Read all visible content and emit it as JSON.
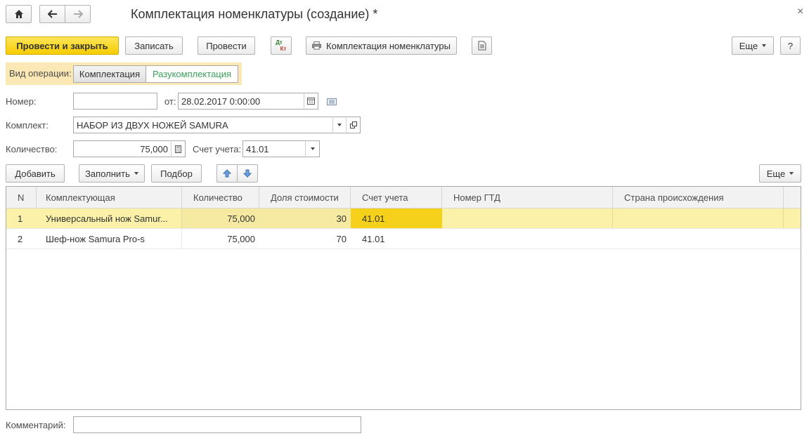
{
  "window": {
    "title": "Комплектация номенклатуры (создание) *",
    "close_glyph": "×"
  },
  "toolbar": {
    "post_and_close": "Провести и закрыть",
    "save": "Записать",
    "post": "Провести",
    "dt_kt_top": "Дт",
    "dt_kt_bottom": "Кт",
    "print_label": "Комплектация номенклатуры",
    "more": "Еще",
    "help": "?"
  },
  "operation": {
    "label": "Вид операции:",
    "options": [
      "Комплектация",
      "Разукомплектация"
    ],
    "selected_color": "#3aa05a"
  },
  "form": {
    "number_label": "Номер:",
    "number_value": "",
    "date_label": "от:",
    "date_value": "28.02.2017  0:00:00",
    "kit_label": "Комплект:",
    "kit_value": "НАБОР ИЗ ДВУХ НОЖЕЙ SAMURA",
    "qty_label": "Количество:",
    "qty_value": "75,000",
    "account_label": "Счет учета:",
    "account_value": "41.01",
    "comment_label": "Комментарий:",
    "comment_value": ""
  },
  "table_toolbar": {
    "add": "Добавить",
    "fill": "Заполнить",
    "pick": "Подбор",
    "more": "Еще"
  },
  "table": {
    "columns": [
      "N",
      "Комплектующая",
      "Количество",
      "Доля стоимости",
      "Счет учета",
      "Номер ГТД",
      "Страна происхождения"
    ],
    "rows": [
      {
        "n": "1",
        "item": "Универсальный нож Samur...",
        "qty": "75,000",
        "share": "30",
        "account": "41.01",
        "gtd": "",
        "country": ""
      },
      {
        "n": "2",
        "item": "Шеф-нож Samura  Pro-s",
        "qty": "75,000",
        "share": "70",
        "account": "41.01",
        "gtd": "",
        "country": ""
      }
    ],
    "selected_row_color": "#fbf1a8",
    "selected_cell_color": "#f5d11b"
  }
}
